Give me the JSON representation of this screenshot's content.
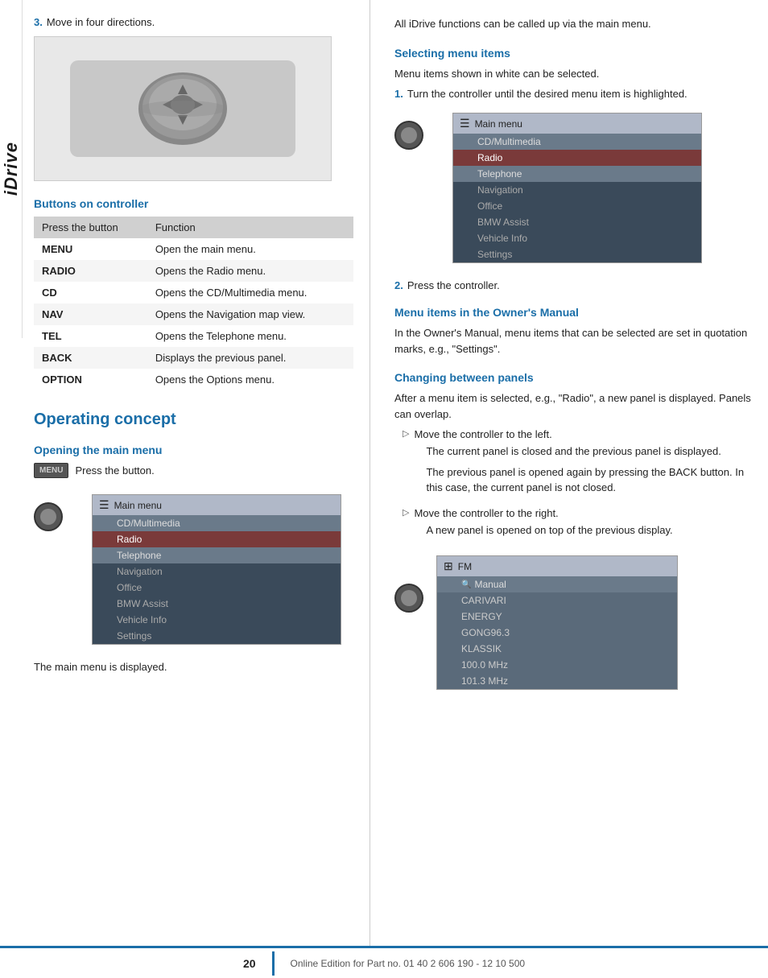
{
  "sidebar": {
    "label": "iDrive"
  },
  "left_col": {
    "step3": {
      "number": "3.",
      "text": "Move in four directions."
    },
    "buttons_section": {
      "heading": "Buttons on controller",
      "table_header": [
        "Press the button",
        "Function"
      ],
      "rows": [
        {
          "button": "MENU",
          "function": "Open the main menu."
        },
        {
          "button": "RADIO",
          "function": "Opens the Radio menu."
        },
        {
          "button": "CD",
          "function": "Opens the CD/Multimedia menu."
        },
        {
          "button": "NAV",
          "function": "Opens the Navigation map view."
        },
        {
          "button": "TEL",
          "function": "Opens the Telephone menu."
        },
        {
          "button": "BACK",
          "function": "Displays the previous panel."
        },
        {
          "button": "OPTION",
          "function": "Opens the Options menu."
        }
      ]
    },
    "operating_concept": {
      "heading": "Operating concept"
    },
    "opening_main_menu": {
      "heading": "Opening the main menu",
      "press_text": "Press the button.",
      "menu_label": "MENU",
      "main_menu_title": "Main menu",
      "menu_items": [
        {
          "text": "CD/Multimedia",
          "style": "normal"
        },
        {
          "text": "Radio",
          "style": "highlighted"
        },
        {
          "text": "Telephone",
          "style": "normal"
        },
        {
          "text": "Navigation",
          "style": "dark"
        },
        {
          "text": "Office",
          "style": "dark"
        },
        {
          "text": "BMW Assist",
          "style": "dark"
        },
        {
          "text": "Vehicle Info",
          "style": "dark"
        },
        {
          "text": "Settings",
          "style": "dark"
        }
      ],
      "caption": "The main menu is displayed."
    }
  },
  "right_col": {
    "intro_text": "All iDrive functions can be called up via the main menu.",
    "selecting_menu_items": {
      "heading": "Selecting menu items",
      "intro": "Menu items shown in white can be selected.",
      "step1": {
        "number": "1.",
        "text": "Turn the controller until the desired menu item is highlighted."
      },
      "main_menu_title": "Main menu",
      "menu_items": [
        {
          "text": "CD/Multimedia",
          "style": "normal"
        },
        {
          "text": "Radio",
          "style": "highlighted"
        },
        {
          "text": "Telephone",
          "style": "normal"
        },
        {
          "text": "Navigation",
          "style": "dark"
        },
        {
          "text": "Office",
          "style": "dark"
        },
        {
          "text": "BMW Assist",
          "style": "dark"
        },
        {
          "text": "Vehicle Info",
          "style": "dark"
        },
        {
          "text": "Settings",
          "style": "dark"
        }
      ],
      "step2": {
        "number": "2.",
        "text": "Press the controller."
      }
    },
    "menu_items_owners_manual": {
      "heading": "Menu items in the Owner's Manual",
      "text": "In the Owner's Manual, menu items that can be selected are set in quotation marks, e.g., \"Settings\"."
    },
    "changing_between_panels": {
      "heading": "Changing between panels",
      "intro": "After a menu item is selected, e.g., \"Radio\", a new panel is displayed. Panels can overlap.",
      "bullet1": {
        "arrow": "▷",
        "text": "Move the controller to the left.",
        "sub1": "The current panel is closed and the previous panel is displayed.",
        "sub2": "The previous panel is opened again by pressing the BACK button. In this case, the current panel is not closed."
      },
      "bullet2": {
        "arrow": "▷",
        "text": "Move the controller to the right.",
        "sub1": "A new panel is opened on top of the previous display."
      }
    },
    "fm_menu": {
      "title": "FM",
      "items": [
        {
          "text": "Manual",
          "icon": true
        },
        {
          "text": "CARIVARI"
        },
        {
          "text": "ENERGY"
        },
        {
          "text": "GONG96.3"
        },
        {
          "text": "KLASSIK"
        },
        {
          "text": "100.0 MHz"
        },
        {
          "text": "101.3 MHz"
        }
      ]
    }
  },
  "footer": {
    "page_number": "20",
    "text": "Online Edition for Part no. 01 40 2 606 190 - 12 10 500"
  }
}
